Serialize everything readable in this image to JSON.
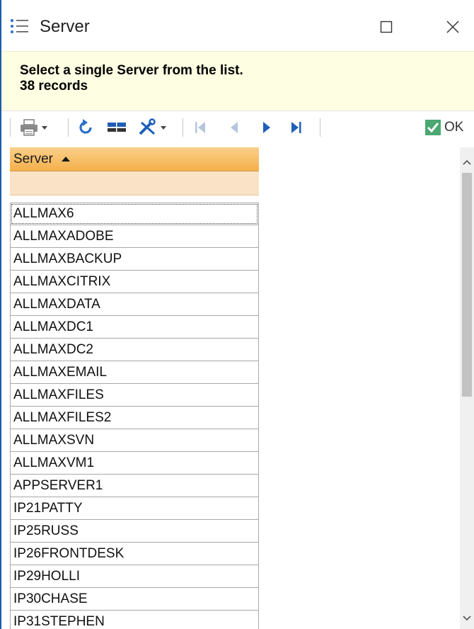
{
  "window": {
    "title": "Server"
  },
  "message": {
    "instruction": "Select a single Server from the list.",
    "record_count": "38 records"
  },
  "toolbar": {
    "items": [
      {
        "icon": "printer-icon"
      },
      {
        "icon": "refresh-icon"
      },
      {
        "icon": "columns-icon"
      },
      {
        "icon": "tools-icon"
      },
      {
        "icon": "first-record-icon"
      },
      {
        "icon": "previous-record-icon"
      },
      {
        "icon": "next-record-icon"
      },
      {
        "icon": "last-record-icon"
      }
    ],
    "ok_label": "OK"
  },
  "grid": {
    "column_header": "Server",
    "sort": "ascending",
    "filter_value": "",
    "rows": [
      "ALLMAX6",
      "ALLMAXADOBE",
      "ALLMAXBACKUP",
      "ALLMAXCITRIX",
      "ALLMAXDATA",
      "ALLMAXDC1",
      "ALLMAXDC2",
      "ALLMAXEMAIL",
      "ALLMAXFILES",
      "ALLMAXFILES2",
      "ALLMAXSVN",
      "ALLMAXVM1",
      "APPSERVER1",
      "IP21PATTY",
      "IP25RUSS",
      "IP26FRONTDESK",
      "IP29HOLLI",
      "IP30CHASE",
      "IP31STEPHEN"
    ]
  },
  "colors": {
    "accent_blue": "#1e5aa8",
    "ok_check_green": "#4aa870",
    "header_orange": "#f4b04c",
    "message_bg": "#fefee2"
  }
}
